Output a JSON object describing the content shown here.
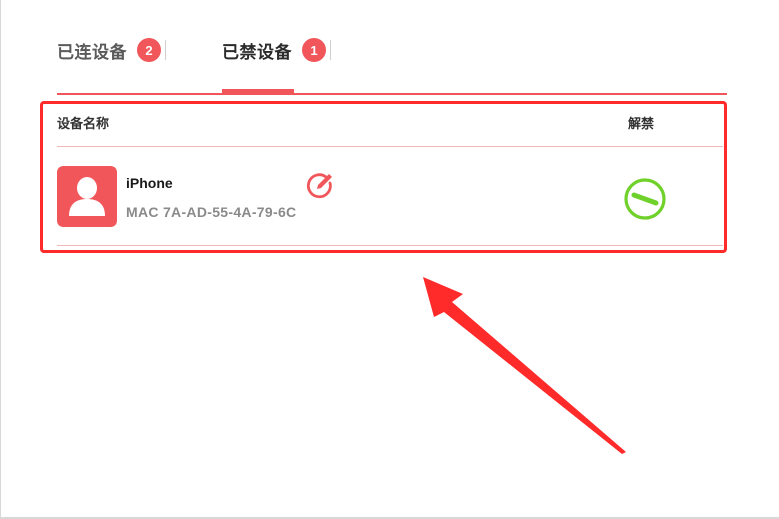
{
  "colors": {
    "accent": "#f0565a",
    "badge": "#f0565a",
    "highlight": "#ff2a2a",
    "unblock": "#6fd12a"
  },
  "tabs": [
    {
      "label": "已连设备",
      "count": "2"
    },
    {
      "label": "已禁设备",
      "count": "1"
    }
  ],
  "active_tab": "已禁设备",
  "table": {
    "col_name": "设备名称",
    "col_action": "解禁"
  },
  "devices": [
    {
      "name": "iPhone",
      "mac": "MAC 7A-AD-55-4A-79-6C",
      "avatar_icon": "user-avatar-icon",
      "edit_icon": "edit-pencil-icon",
      "action_icon": "unblock-minus-icon"
    }
  ],
  "annotation_icon": "red-arrow-icon"
}
